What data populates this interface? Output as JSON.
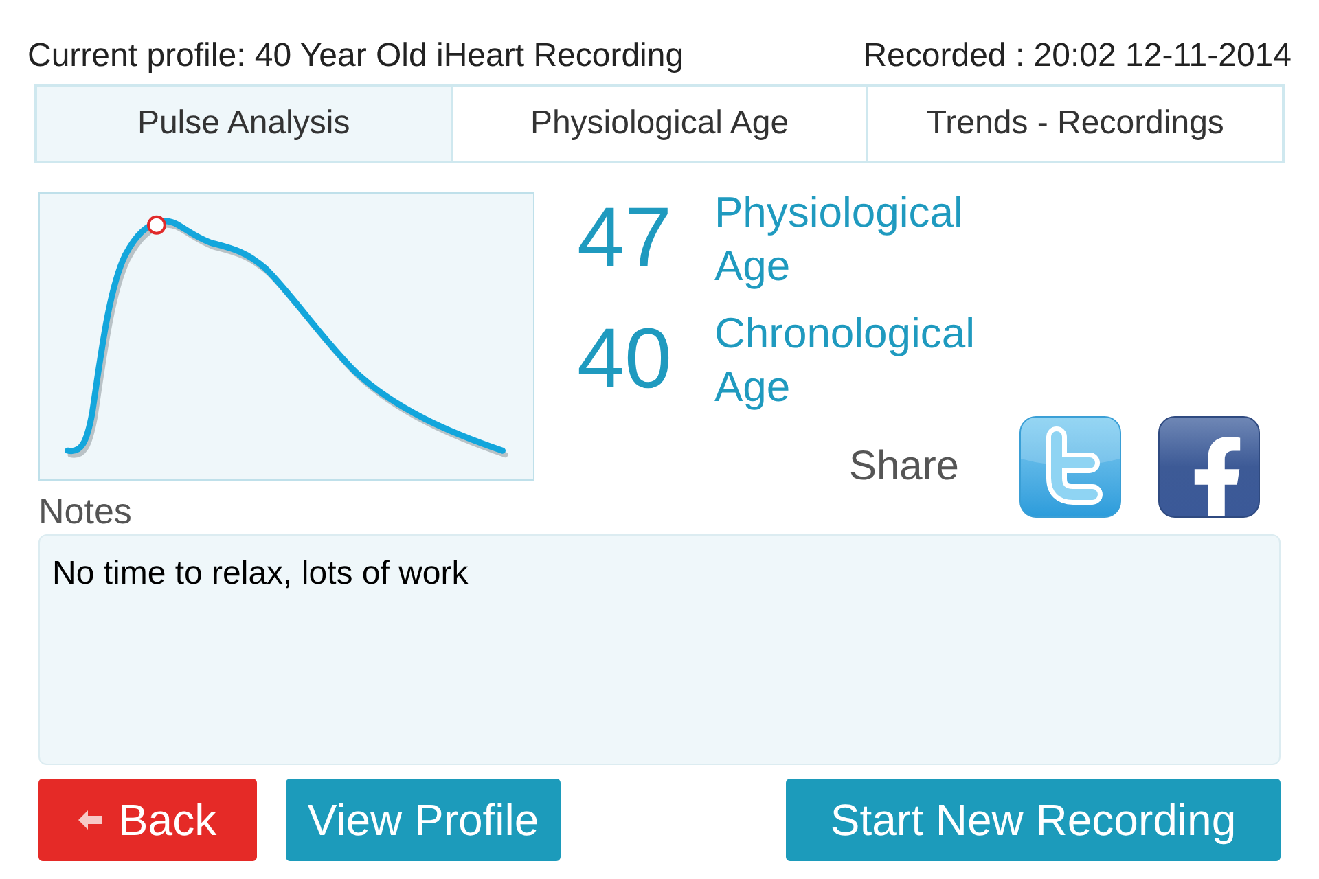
{
  "header": {
    "profile": "Current profile: 40 Year Old iHeart Recording",
    "recorded": "Recorded : 20:02 12-11-2014"
  },
  "tabs": [
    {
      "label": "Pulse Analysis",
      "selected": true
    },
    {
      "label": "Physiological Age",
      "selected": false
    },
    {
      "label": "Trends - Recordings",
      "selected": false
    }
  ],
  "results": [
    {
      "value": "47",
      "label": "Physiological Age"
    },
    {
      "value": "40",
      "label": "Chronological Age"
    }
  ],
  "share": {
    "label": "Share",
    "buttons": [
      {
        "kind": "twitter"
      },
      {
        "kind": "facebook"
      }
    ]
  },
  "notes": {
    "label": "Notes",
    "value": "No time to relax, lots of work"
  },
  "buttons": [
    {
      "kind": "back",
      "label": "Back"
    },
    {
      "kind": "primary",
      "label": "View Profile"
    },
    {
      "kind": "primary",
      "label": "Start New Recording"
    }
  ]
}
